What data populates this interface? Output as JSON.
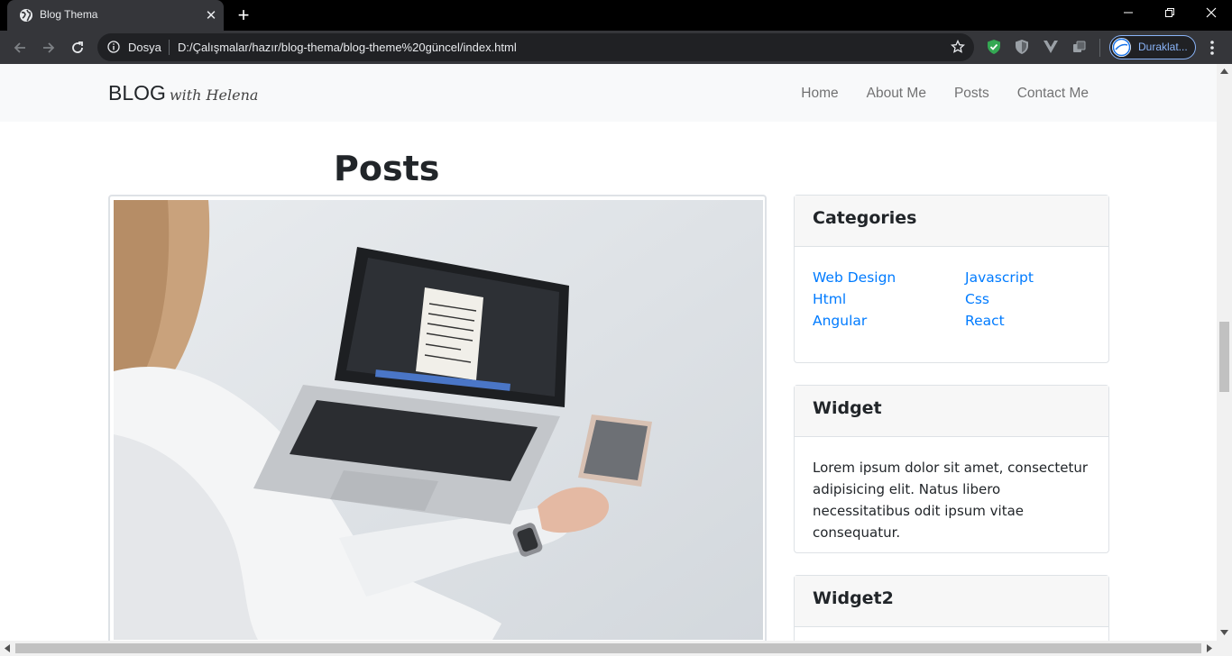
{
  "browser": {
    "tab_title": "Blog Thema",
    "tab_close_glyph": "✕",
    "new_tab_glyph": "+",
    "site_security_label": "Dosya",
    "url": "D:/Çalışmalar/hazır/blog-thema/blog-theme%20güncel/index.html",
    "profile_label": "Duraklat...",
    "icons": [
      "globe-icon",
      "back-icon",
      "forward-icon",
      "reload-icon",
      "info-icon",
      "star-icon",
      "shield-extension-icon",
      "brave-shield-icon",
      "vue-devtools-icon",
      "window-extension-icon",
      "menu-icon"
    ]
  },
  "navbar": {
    "brand": "BLOG",
    "brand_sub": "with Helena",
    "links": [
      "Home",
      "About Me",
      "Posts",
      "Contact Me"
    ]
  },
  "main": {
    "title": "Posts",
    "post_image_alt": "woman using laptop"
  },
  "sidebar": {
    "categories": {
      "title": "Categories",
      "left": [
        "Web Design",
        "Html",
        "Angular"
      ],
      "right": [
        "Javascript",
        "Css",
        "React"
      ]
    },
    "widget": {
      "title": "Widget",
      "text": "Lorem ipsum dolor sit amet, consectetur adipisicing elit. Natus libero necessitatibus odit ipsum vitae consequatur."
    },
    "widget2": {
      "title": "Widget2"
    }
  },
  "colors": {
    "link": "#007bff",
    "navbar_bg": "#f8f9fa",
    "chrome_dark": "#35363a",
    "profile_accent": "#8ab4f8"
  }
}
